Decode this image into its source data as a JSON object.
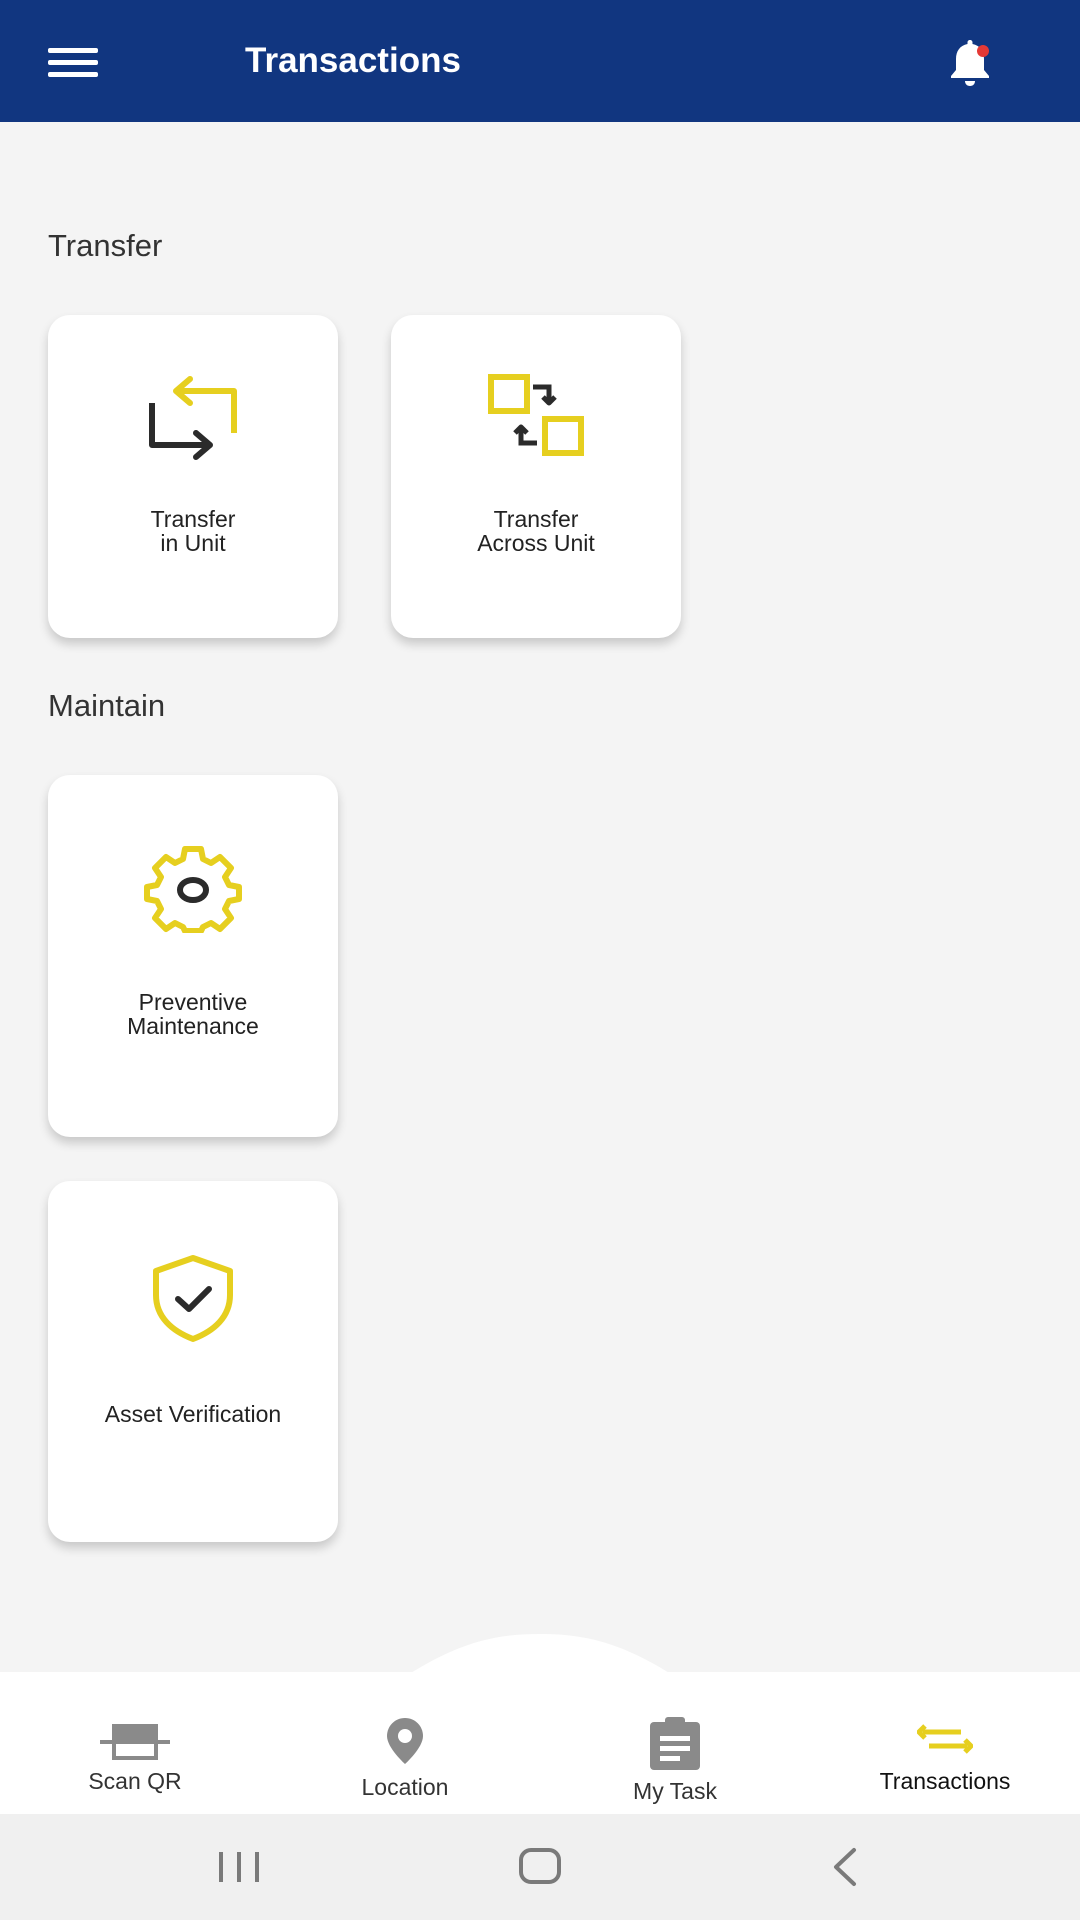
{
  "header": {
    "title": "Transactions",
    "menu_icon": "hamburger-menu-icon",
    "notification_icon": "bell-icon",
    "notification_dot_color": "#e53935"
  },
  "colors": {
    "app_bar": "#113680",
    "accent": "#e6cf1f",
    "icon_dark": "#2b2b2b"
  },
  "sections": {
    "transfer": {
      "title": "Transfer",
      "cards": [
        {
          "label": "Transfer\nin Unit",
          "icon": "transfer-in-unit-icon"
        },
        {
          "label": "Transfer\nAcross Unit",
          "icon": "transfer-across-unit-icon"
        }
      ]
    },
    "maintain": {
      "title": "Maintain",
      "cards": [
        {
          "label": "Preventive\nMaintenance",
          "icon": "gear-icon"
        },
        {
          "label": "Asset Verification",
          "icon": "shield-check-icon"
        }
      ]
    }
  },
  "bottom_nav": {
    "items": [
      {
        "label": "Scan QR",
        "icon": "scan-qr-icon",
        "active": false
      },
      {
        "label": "Location",
        "icon": "location-pin-icon",
        "active": false
      },
      {
        "label": "My Task",
        "icon": "clipboard-icon",
        "active": false
      },
      {
        "label": "Transactions",
        "icon": "transactions-arrows-icon",
        "active": true
      }
    ]
  },
  "system_nav": {
    "recents_icon": "recents-icon",
    "home_icon": "home-icon",
    "back_icon": "back-icon"
  }
}
